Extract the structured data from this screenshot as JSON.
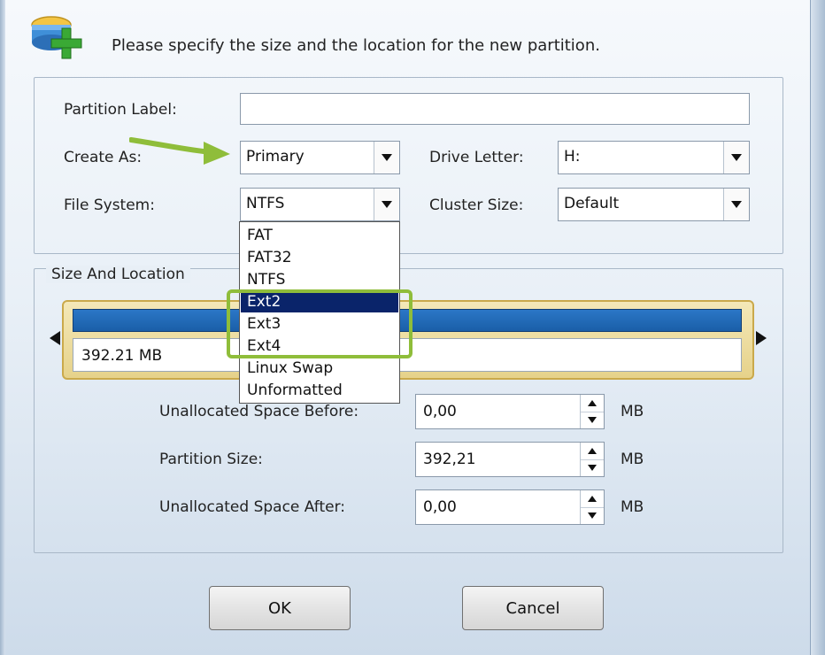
{
  "prompt": "Please specify the size and the location for the new partition.",
  "general": {
    "partition_label": {
      "label": "Partition Label:",
      "value": ""
    },
    "create_as": {
      "label": "Create As:",
      "value": "Primary"
    },
    "drive_letter": {
      "label": "Drive Letter:",
      "value": "H:"
    },
    "file_system": {
      "label": "File System:",
      "value": "NTFS"
    },
    "cluster_size": {
      "label": "Cluster Size:",
      "value": "Default"
    }
  },
  "file_system_options": [
    "FAT",
    "FAT32",
    "NTFS",
    "Ext2",
    "Ext3",
    "Ext4",
    "Linux Swap",
    "Unformatted"
  ],
  "highlighted_option": "Ext2",
  "size_location": {
    "title": "Size And Location",
    "bar_size": "392.21 MB",
    "unallocated_before": {
      "label": "Unallocated Space Before:",
      "value": "0,00",
      "unit": "MB"
    },
    "partition_size": {
      "label": "Partition Size:",
      "value": "392,21",
      "unit": "MB"
    },
    "unallocated_after": {
      "label": "Unallocated Space After:",
      "value": "0,00",
      "unit": "MB"
    }
  },
  "buttons": {
    "ok": "OK",
    "cancel": "Cancel"
  },
  "colors": {
    "accent_green": "#8fbd3a",
    "selection_blue": "#0a246a",
    "bar_blue": "#1a5ea8"
  }
}
